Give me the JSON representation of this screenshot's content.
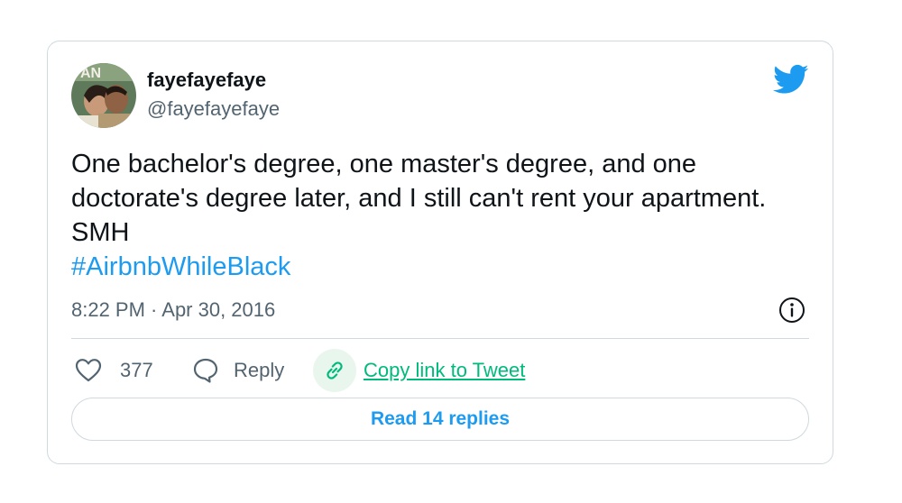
{
  "tweet": {
    "author": {
      "display_name": "fayefayefaye",
      "handle": "@fayefayefaye",
      "avatar_icon": "user-avatar-photo"
    },
    "text_lines": [
      "One bachelor's degree, one master's degree, and one",
      "doctorate's degree later, and I still can't rent your apartment.",
      "SMH"
    ],
    "hashtag": "#AirbnbWhileBlack",
    "timestamp": "8:22 PM · Apr 30, 2016",
    "actions": {
      "like_count": "377",
      "reply_label": "Reply",
      "copy_link_label": "Copy link to Tweet"
    },
    "read_replies_label": "Read 14 replies"
  },
  "icons": {
    "brand": "twitter-bird-icon",
    "info": "info-icon",
    "like": "heart-icon",
    "reply": "speech-bubble-icon",
    "copy": "link-icon"
  },
  "colors": {
    "brand_blue": "#1d9bf0",
    "copy_green": "#00ba7c",
    "text_primary": "#0f1419",
    "text_secondary": "#536471",
    "border": "#cfd9de"
  }
}
